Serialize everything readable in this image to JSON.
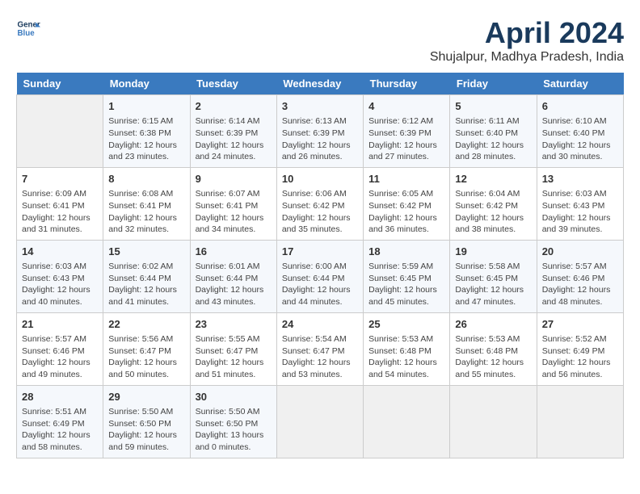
{
  "header": {
    "logo_line1": "General",
    "logo_line2": "Blue",
    "month": "April 2024",
    "location": "Shujalpur, Madhya Pradesh, India"
  },
  "weekdays": [
    "Sunday",
    "Monday",
    "Tuesday",
    "Wednesday",
    "Thursday",
    "Friday",
    "Saturday"
  ],
  "weeks": [
    [
      {
        "day": "",
        "info": ""
      },
      {
        "day": "1",
        "info": "Sunrise: 6:15 AM\nSunset: 6:38 PM\nDaylight: 12 hours\nand 23 minutes."
      },
      {
        "day": "2",
        "info": "Sunrise: 6:14 AM\nSunset: 6:39 PM\nDaylight: 12 hours\nand 24 minutes."
      },
      {
        "day": "3",
        "info": "Sunrise: 6:13 AM\nSunset: 6:39 PM\nDaylight: 12 hours\nand 26 minutes."
      },
      {
        "day": "4",
        "info": "Sunrise: 6:12 AM\nSunset: 6:39 PM\nDaylight: 12 hours\nand 27 minutes."
      },
      {
        "day": "5",
        "info": "Sunrise: 6:11 AM\nSunset: 6:40 PM\nDaylight: 12 hours\nand 28 minutes."
      },
      {
        "day": "6",
        "info": "Sunrise: 6:10 AM\nSunset: 6:40 PM\nDaylight: 12 hours\nand 30 minutes."
      }
    ],
    [
      {
        "day": "7",
        "info": "Sunrise: 6:09 AM\nSunset: 6:41 PM\nDaylight: 12 hours\nand 31 minutes."
      },
      {
        "day": "8",
        "info": "Sunrise: 6:08 AM\nSunset: 6:41 PM\nDaylight: 12 hours\nand 32 minutes."
      },
      {
        "day": "9",
        "info": "Sunrise: 6:07 AM\nSunset: 6:41 PM\nDaylight: 12 hours\nand 34 minutes."
      },
      {
        "day": "10",
        "info": "Sunrise: 6:06 AM\nSunset: 6:42 PM\nDaylight: 12 hours\nand 35 minutes."
      },
      {
        "day": "11",
        "info": "Sunrise: 6:05 AM\nSunset: 6:42 PM\nDaylight: 12 hours\nand 36 minutes."
      },
      {
        "day": "12",
        "info": "Sunrise: 6:04 AM\nSunset: 6:42 PM\nDaylight: 12 hours\nand 38 minutes."
      },
      {
        "day": "13",
        "info": "Sunrise: 6:03 AM\nSunset: 6:43 PM\nDaylight: 12 hours\nand 39 minutes."
      }
    ],
    [
      {
        "day": "14",
        "info": "Sunrise: 6:03 AM\nSunset: 6:43 PM\nDaylight: 12 hours\nand 40 minutes."
      },
      {
        "day": "15",
        "info": "Sunrise: 6:02 AM\nSunset: 6:44 PM\nDaylight: 12 hours\nand 41 minutes."
      },
      {
        "day": "16",
        "info": "Sunrise: 6:01 AM\nSunset: 6:44 PM\nDaylight: 12 hours\nand 43 minutes."
      },
      {
        "day": "17",
        "info": "Sunrise: 6:00 AM\nSunset: 6:44 PM\nDaylight: 12 hours\nand 44 minutes."
      },
      {
        "day": "18",
        "info": "Sunrise: 5:59 AM\nSunset: 6:45 PM\nDaylight: 12 hours\nand 45 minutes."
      },
      {
        "day": "19",
        "info": "Sunrise: 5:58 AM\nSunset: 6:45 PM\nDaylight: 12 hours\nand 47 minutes."
      },
      {
        "day": "20",
        "info": "Sunrise: 5:57 AM\nSunset: 6:46 PM\nDaylight: 12 hours\nand 48 minutes."
      }
    ],
    [
      {
        "day": "21",
        "info": "Sunrise: 5:57 AM\nSunset: 6:46 PM\nDaylight: 12 hours\nand 49 minutes."
      },
      {
        "day": "22",
        "info": "Sunrise: 5:56 AM\nSunset: 6:47 PM\nDaylight: 12 hours\nand 50 minutes."
      },
      {
        "day": "23",
        "info": "Sunrise: 5:55 AM\nSunset: 6:47 PM\nDaylight: 12 hours\nand 51 minutes."
      },
      {
        "day": "24",
        "info": "Sunrise: 5:54 AM\nSunset: 6:47 PM\nDaylight: 12 hours\nand 53 minutes."
      },
      {
        "day": "25",
        "info": "Sunrise: 5:53 AM\nSunset: 6:48 PM\nDaylight: 12 hours\nand 54 minutes."
      },
      {
        "day": "26",
        "info": "Sunrise: 5:53 AM\nSunset: 6:48 PM\nDaylight: 12 hours\nand 55 minutes."
      },
      {
        "day": "27",
        "info": "Sunrise: 5:52 AM\nSunset: 6:49 PM\nDaylight: 12 hours\nand 56 minutes."
      }
    ],
    [
      {
        "day": "28",
        "info": "Sunrise: 5:51 AM\nSunset: 6:49 PM\nDaylight: 12 hours\nand 58 minutes."
      },
      {
        "day": "29",
        "info": "Sunrise: 5:50 AM\nSunset: 6:50 PM\nDaylight: 12 hours\nand 59 minutes."
      },
      {
        "day": "30",
        "info": "Sunrise: 5:50 AM\nSunset: 6:50 PM\nDaylight: 13 hours\nand 0 minutes."
      },
      {
        "day": "",
        "info": ""
      },
      {
        "day": "",
        "info": ""
      },
      {
        "day": "",
        "info": ""
      },
      {
        "day": "",
        "info": ""
      }
    ]
  ]
}
